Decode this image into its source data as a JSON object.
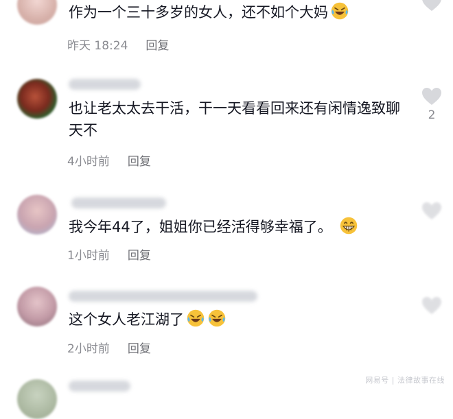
{
  "comments": [
    {
      "text": "作为一个三十多岁的女人，还不如个大妈",
      "time": "昨天 18:24",
      "reply": "回复",
      "like_count": "",
      "emoji": "laughing-crying"
    },
    {
      "text": "也让老太太去干活，干一天看看回来还有闲情逸致聊天不",
      "time": "4小时前",
      "reply": "回复",
      "like_count": "2",
      "emoji": ""
    },
    {
      "text": "我今年44了，姐姐你已经活得够幸福了。",
      "time": "1小时前",
      "reply": "回复",
      "like_count": "",
      "emoji": "grinning"
    },
    {
      "text": "这个女人老江湖了",
      "time": "2小时前",
      "reply": "回复",
      "like_count": "",
      "emoji": "laughing-crying x2"
    }
  ],
  "watermark": "网易号 | 法律故事在线",
  "colors": {
    "text": "#161823",
    "meta": "#8a8b91",
    "heart": "#d7d8dc",
    "emoji": "#f7c23a"
  }
}
